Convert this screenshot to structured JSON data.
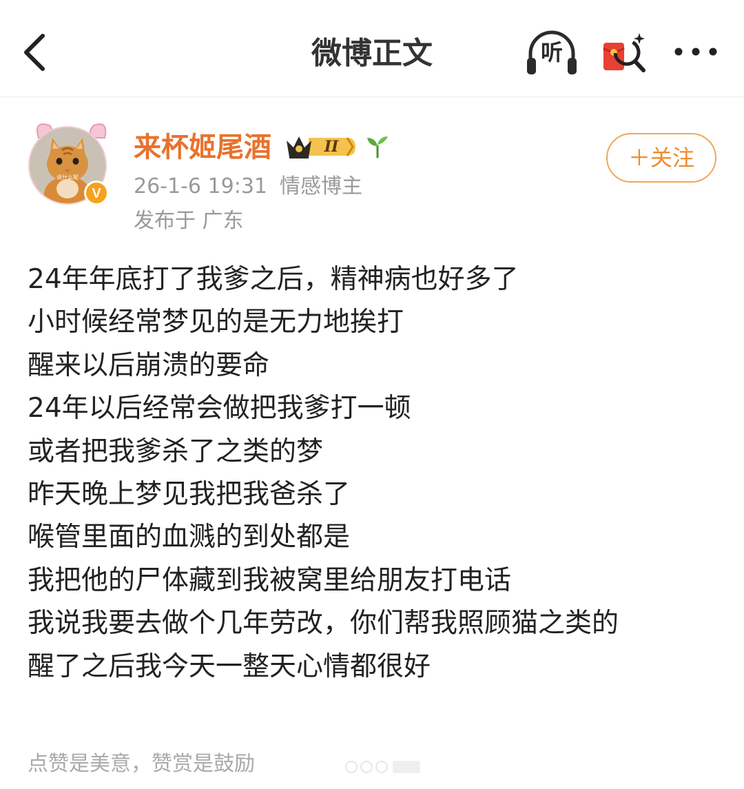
{
  "navbar": {
    "title": "微博正文",
    "listen_label": "听"
  },
  "author": {
    "name": "来杯姬尾酒",
    "vip_level": "II",
    "avatar_caption": "说什么呢",
    "verified_mark": "V"
  },
  "post": {
    "timestamp": "26-1-6 19:31",
    "author_tag": "情感博主",
    "location": "发布于 广东",
    "lines": [
      "24年年底打了我爹之后，精神病也好多了",
      "小时候经常梦见的是无力地挨打",
      "醒来以后崩溃的要命",
      "24年以后经常会做把我爹打一顿",
      "或者把我爹杀了之类的梦",
      "昨天晚上梦见我把我爸杀了",
      "喉管里面的血溅的到处都是",
      "我把他的尸体藏到我被窝里给朋友打电话",
      "我说我要去做个几年劳改，你们帮我照顾猫之类的",
      "醒了之后我今天一整天心情都很好"
    ]
  },
  "follow_button": {
    "label": "＋关注"
  },
  "footer": {
    "reward_text": "点赞是美意，赞赏是鼓励"
  },
  "colors": {
    "author_name": "#e8722d",
    "follow_border": "#f0a75a",
    "verified_badge": "#f7a21b",
    "meta_text": "#999999"
  },
  "icons": {
    "back": "chevron-left-icon",
    "listen": "headphones-icon",
    "redpacket": "red-packet-search-icon",
    "more": "more-dots-icon",
    "vip": "crown-badge-icon",
    "sprout": "sprout-icon",
    "verified": "verified-v-icon"
  }
}
